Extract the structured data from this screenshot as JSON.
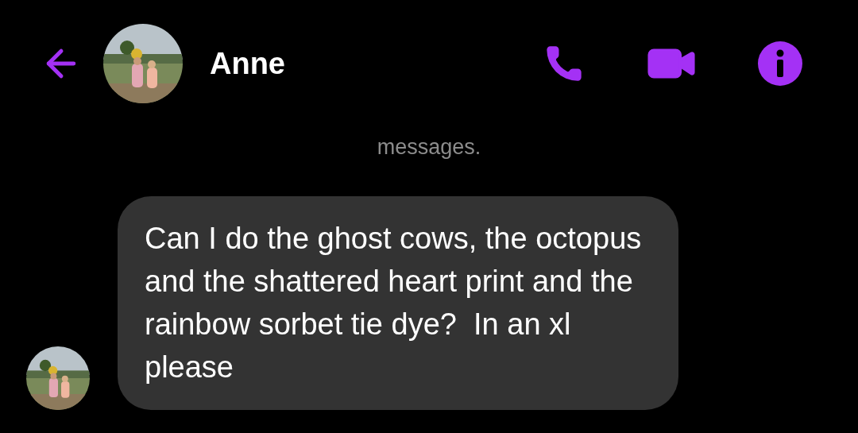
{
  "header": {
    "contact_name": "Anne"
  },
  "notice": "messages.",
  "messages": [
    {
      "text": "Can I do the ghost cows, the octopus and the shattered heart print and the rainbow sorbet tie dye?  In an xl please",
      "incoming": true
    }
  ]
}
